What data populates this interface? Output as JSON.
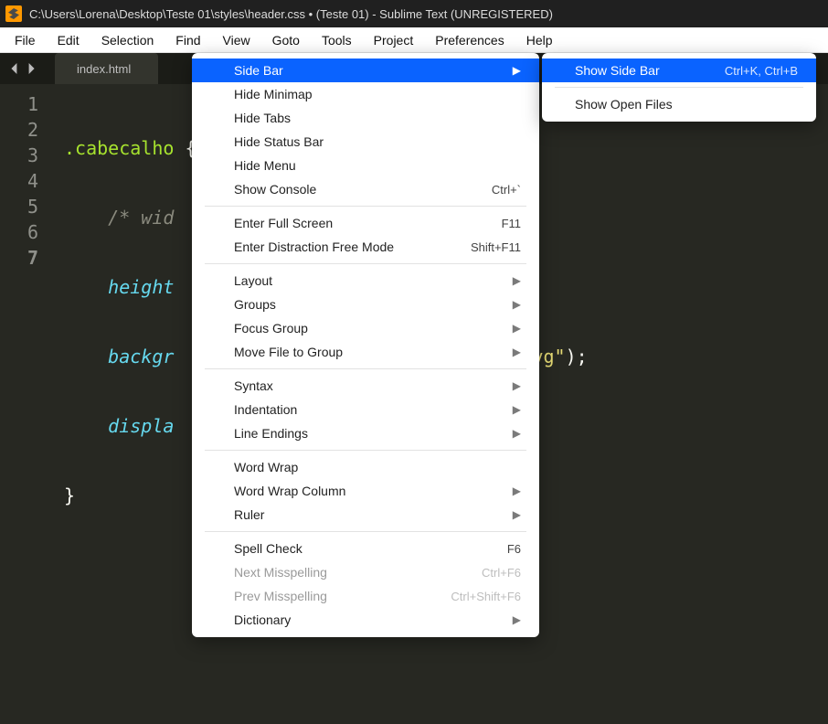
{
  "titlebar": {
    "path": "C:\\Users\\Lorena\\Desktop\\Teste 01\\styles\\header.css • (Teste 01) - Sublime Text (UNREGISTERED)"
  },
  "menubar": {
    "items": [
      "File",
      "Edit",
      "Selection",
      "Find",
      "View",
      "Goto",
      "Tools",
      "Project",
      "Preferences",
      "Help"
    ]
  },
  "tabs": {
    "items": [
      {
        "label": "index.html",
        "dirty": false
      }
    ]
  },
  "editor": {
    "line_numbers": [
      "1",
      "2",
      "3",
      "4",
      "5",
      "6",
      "7"
    ],
    "code": {
      "l1_sel": ".cabecalho",
      "l1_brace": " {",
      "l2": "    /* wid",
      "l3": "    height",
      "l4_prop": "    backgr",
      "l4_str": "svg\"",
      "l4_end": ");",
      "l5": "    displa",
      "l6": "}",
      "l7": ""
    }
  },
  "view_menu": {
    "items": [
      {
        "kind": "item",
        "label": "Side Bar",
        "shortcut": "",
        "sub": true,
        "hl": true
      },
      {
        "kind": "item",
        "label": "Hide Minimap",
        "shortcut": ""
      },
      {
        "kind": "item",
        "label": "Hide Tabs",
        "shortcut": ""
      },
      {
        "kind": "item",
        "label": "Hide Status Bar",
        "shortcut": ""
      },
      {
        "kind": "item",
        "label": "Hide Menu",
        "shortcut": ""
      },
      {
        "kind": "item",
        "label": "Show Console",
        "shortcut": "Ctrl+`"
      },
      {
        "kind": "sep"
      },
      {
        "kind": "item",
        "label": "Enter Full Screen",
        "shortcut": "F11"
      },
      {
        "kind": "item",
        "label": "Enter Distraction Free Mode",
        "shortcut": "Shift+F11"
      },
      {
        "kind": "sep"
      },
      {
        "kind": "item",
        "label": "Layout",
        "shortcut": "",
        "sub": true
      },
      {
        "kind": "item",
        "label": "Groups",
        "shortcut": "",
        "sub": true
      },
      {
        "kind": "item",
        "label": "Focus Group",
        "shortcut": "",
        "sub": true
      },
      {
        "kind": "item",
        "label": "Move File to Group",
        "shortcut": "",
        "sub": true
      },
      {
        "kind": "sep"
      },
      {
        "kind": "item",
        "label": "Syntax",
        "shortcut": "",
        "sub": true
      },
      {
        "kind": "item",
        "label": "Indentation",
        "shortcut": "",
        "sub": true
      },
      {
        "kind": "item",
        "label": "Line Endings",
        "shortcut": "",
        "sub": true
      },
      {
        "kind": "sep"
      },
      {
        "kind": "item",
        "label": "Word Wrap",
        "shortcut": ""
      },
      {
        "kind": "item",
        "label": "Word Wrap Column",
        "shortcut": "",
        "sub": true
      },
      {
        "kind": "item",
        "label": "Ruler",
        "shortcut": "",
        "sub": true
      },
      {
        "kind": "sep"
      },
      {
        "kind": "item",
        "label": "Spell Check",
        "shortcut": "F6"
      },
      {
        "kind": "item",
        "label": "Next Misspelling",
        "shortcut": "Ctrl+F6",
        "disabled": true
      },
      {
        "kind": "item",
        "label": "Prev Misspelling",
        "shortcut": "Ctrl+Shift+F6",
        "disabled": true
      },
      {
        "kind": "item",
        "label": "Dictionary",
        "shortcut": "",
        "sub": true
      }
    ]
  },
  "sidebar_submenu": {
    "items": [
      {
        "kind": "item",
        "label": "Show Side Bar",
        "shortcut": "Ctrl+K, Ctrl+B",
        "hl": true
      },
      {
        "kind": "sep"
      },
      {
        "kind": "item",
        "label": "Show Open Files",
        "shortcut": ""
      }
    ]
  }
}
